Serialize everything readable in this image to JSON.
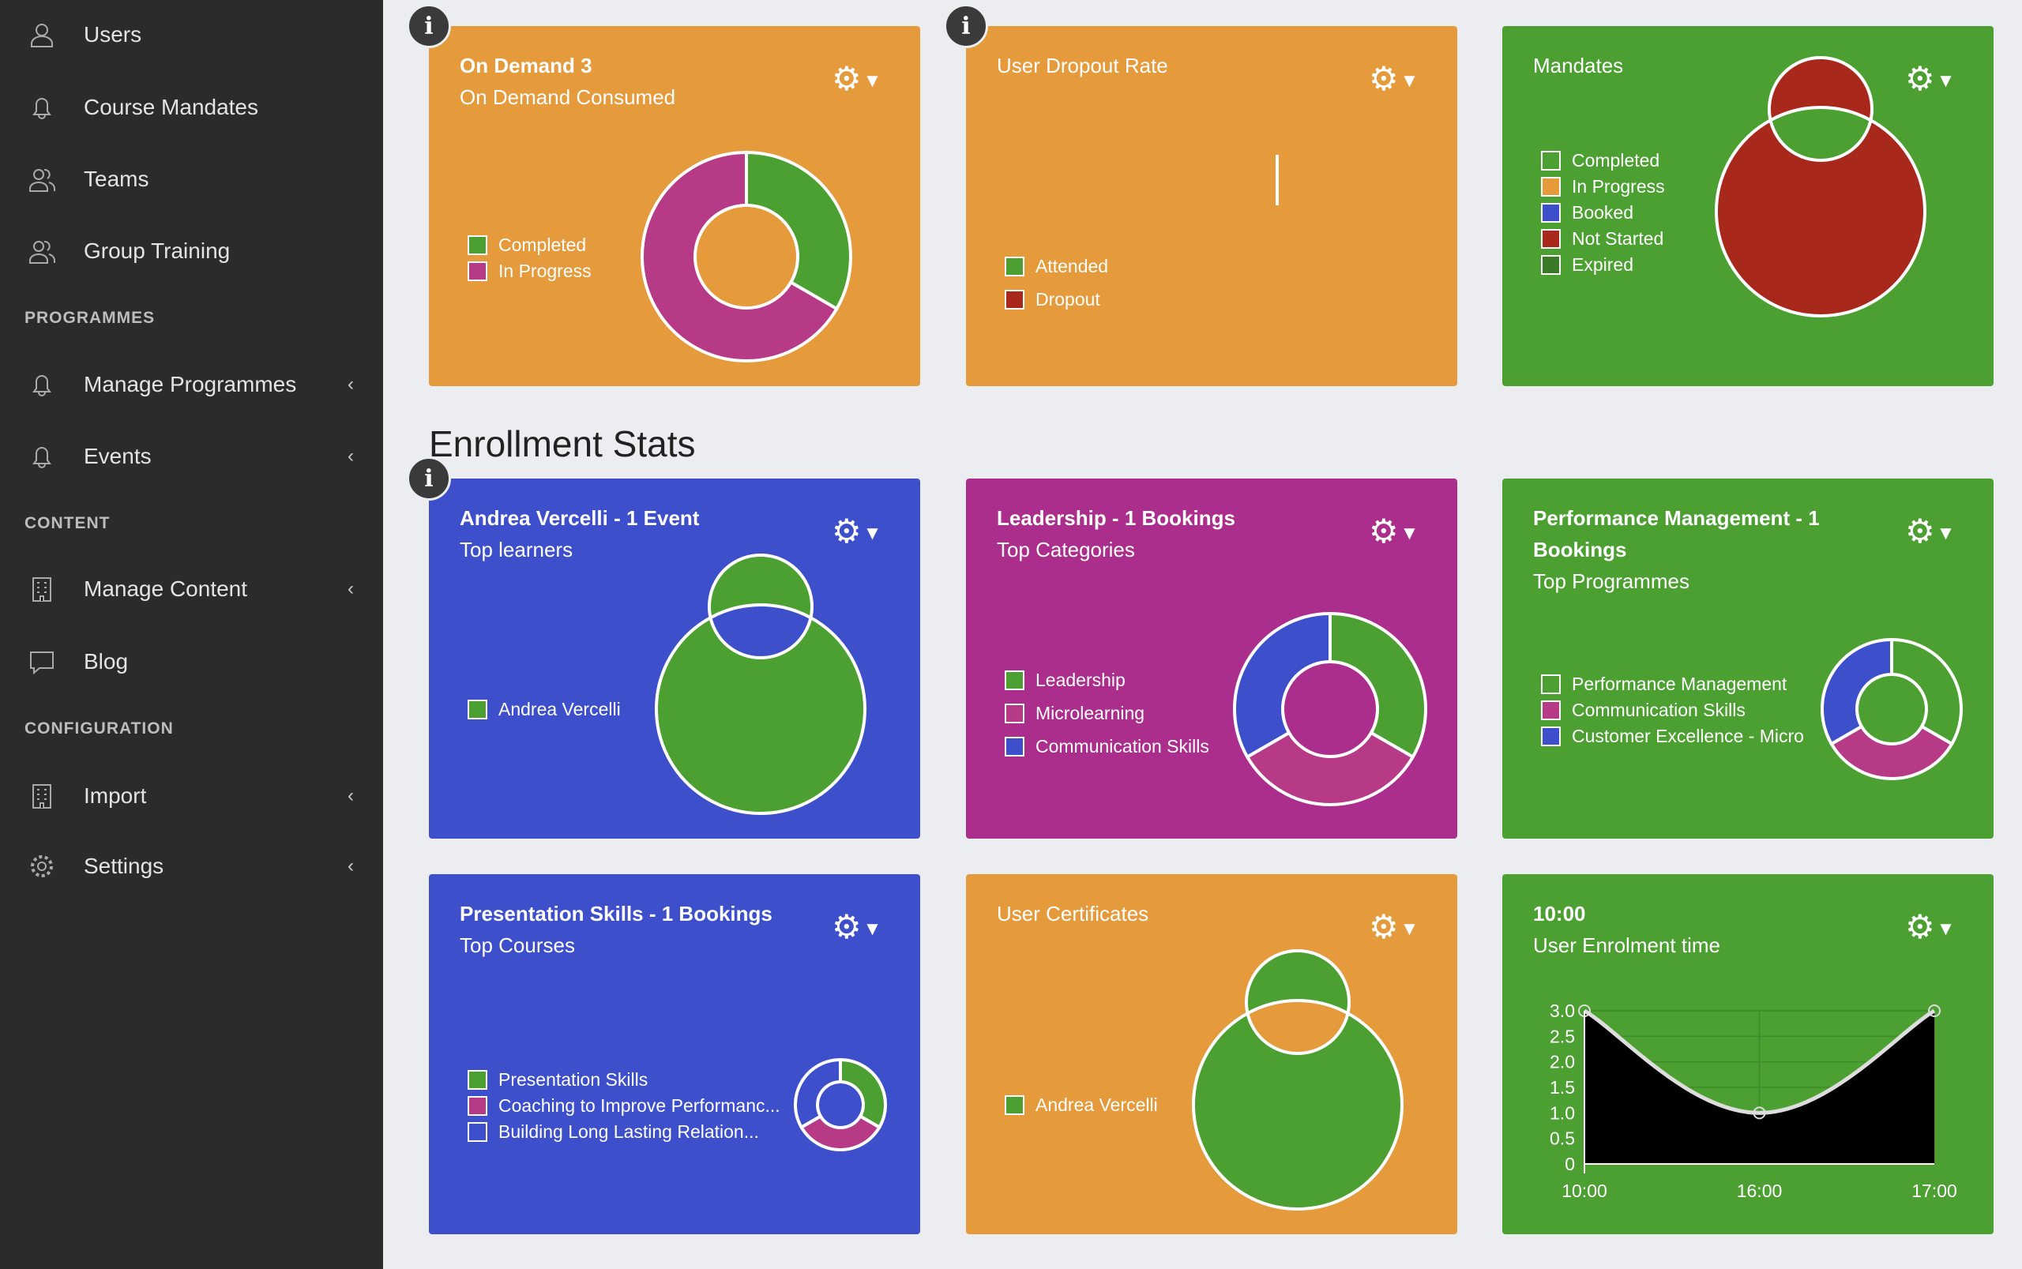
{
  "sidebar": {
    "items": [
      {
        "label": "Users",
        "icon": "user-icon"
      },
      {
        "label": "Course Mandates",
        "icon": "bell-icon"
      },
      {
        "label": "Teams",
        "icon": "users-icon"
      },
      {
        "label": "Group Training",
        "icon": "users-icon"
      },
      {
        "label": "Manage Programmes",
        "icon": "bell-icon",
        "chevron": "‹"
      },
      {
        "label": "Events",
        "icon": "bell-icon",
        "chevron": "‹"
      },
      {
        "label": "Manage Content",
        "icon": "building-icon",
        "chevron": "‹"
      },
      {
        "label": "Blog",
        "icon": "comment-icon"
      },
      {
        "label": "Import",
        "icon": "building-icon",
        "chevron": "‹"
      },
      {
        "label": "Settings",
        "icon": "gear-icon",
        "chevron": "‹"
      }
    ],
    "sections": [
      "PROGRAMMES",
      "CONTENT",
      "CONFIGURATION"
    ]
  },
  "heading": "Enrollment Stats",
  "colors": {
    "orange": "#e59a3b",
    "green": "#4ca032",
    "blue": "#3d4fca",
    "purple": "#ab2e8c",
    "magenta": "#b63a86",
    "red": "#a8281c"
  },
  "cards": [
    {
      "title": "On Demand 3",
      "subtitle": "On Demand Consumed",
      "bg": "#e59a3b",
      "legend": [
        {
          "label": "Completed",
          "color": "#4ca032",
          "value": 1
        },
        {
          "label": "In Progress",
          "color": "#b63a86",
          "value": 2
        }
      ]
    },
    {
      "title": "User Dropout Rate",
      "subtitle": "",
      "bg": "#e59a3b",
      "legend": [
        {
          "label": "Attended",
          "color": "#4ca032",
          "value": 0
        },
        {
          "label": "Dropout",
          "color": "#a8281c",
          "value": 0
        }
      ]
    },
    {
      "title": "Mandates",
      "subtitle": "",
      "bg": "#4ca032",
      "legend": [
        {
          "label": "Completed",
          "color": "#4ca032",
          "value": 0
        },
        {
          "label": "In Progress",
          "color": "#e59a3b",
          "value": 0
        },
        {
          "label": "Booked",
          "color": "#3d4fca",
          "value": 0
        },
        {
          "label": "Not Started",
          "color": "#a8281c",
          "value": 1
        },
        {
          "label": "Expired",
          "color": "#3a7a26",
          "value": 0
        }
      ]
    },
    {
      "title": "Andrea Vercelli - 1 Event",
      "subtitle": "Top learners",
      "bg": "#3d4fca",
      "legend": [
        {
          "label": "Andrea Vercelli",
          "color": "#4ca032",
          "value": 1
        }
      ]
    },
    {
      "title": "Leadership - 1 Bookings",
      "subtitle": "Top Categories",
      "bg": "#ab2e8c",
      "legend": [
        {
          "label": "Leadership",
          "color": "#4ca032",
          "value": 1
        },
        {
          "label": "Microlearning",
          "color": "#b63a86",
          "value": 1
        },
        {
          "label": "Communication Skills",
          "color": "#3d4fca",
          "value": 1
        }
      ]
    },
    {
      "title": "Performance Management - 1 Bookings",
      "subtitle": "Top Programmes",
      "bg": "#4ca032",
      "legend": [
        {
          "label": "Performance Management",
          "color": "#4ca032",
          "value": 1
        },
        {
          "label": "Communication Skills",
          "color": "#b63a86",
          "value": 1
        },
        {
          "label": "Customer Excellence - Micro",
          "color": "#3d4fca",
          "value": 1
        }
      ]
    },
    {
      "title": "Presentation Skills - 1 Bookings",
      "subtitle": "Top Courses",
      "bg": "#3d4fca",
      "legend": [
        {
          "label": "Presentation Skills",
          "color": "#4ca032",
          "value": 1
        },
        {
          "label": "Coaching to Improve Performanc...",
          "color": "#b63a86",
          "value": 1
        },
        {
          "label": "Building Long Lasting Relation...",
          "color": "#3d4fca",
          "value": 1
        }
      ]
    },
    {
      "title": "User Certificates",
      "subtitle": "",
      "bg": "#e59a3b",
      "legend": [
        {
          "label": "Andrea Vercelli",
          "color": "#4ca032",
          "value": 1
        }
      ]
    },
    {
      "title": "10:00",
      "subtitle": "User Enrolment time",
      "bg": "#4ca032",
      "legend": []
    }
  ],
  "chart_data": {
    "type": "area",
    "categories": [
      "10:00",
      "16:00",
      "17:00"
    ],
    "values": [
      3,
      1,
      3
    ],
    "ylim": [
      0,
      3
    ],
    "yticks": [
      "0",
      "0.5",
      "1.0",
      "1.5",
      "2.0",
      "2.5",
      "3.0"
    ],
    "fill": "#000000",
    "line": "#dddddd",
    "grid": true
  }
}
